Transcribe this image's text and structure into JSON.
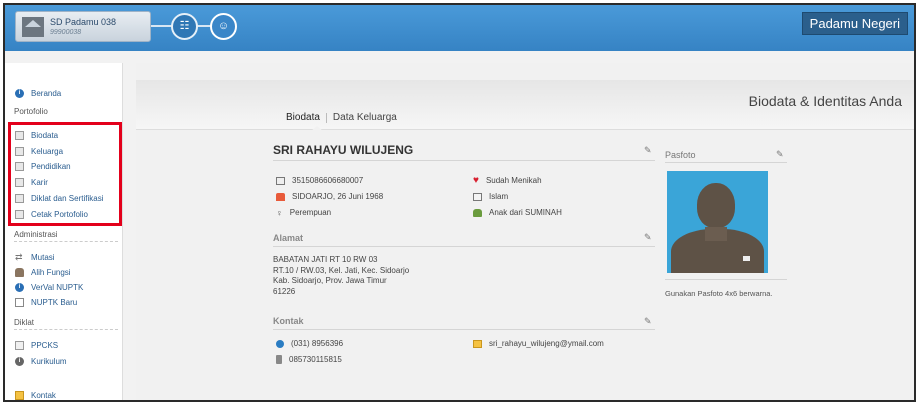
{
  "topbar": {
    "school_name": "SD Padamu 038",
    "school_id": "99900038",
    "brand": "Padamu Negeri"
  },
  "sidebar": {
    "home": "Beranda",
    "portfolio_heading": "Portofolio",
    "portfolio_items": [
      "Biodata",
      "Keluarga",
      "Pendidikan",
      "Karir",
      "Diklat dan Sertifikasi",
      "Cetak Portofolio"
    ],
    "admin_heading": "Administrasi",
    "admin_items": [
      "Mutasi",
      "Alih Fungsi",
      "VerVal NUPTK",
      "NUPTK Baru"
    ],
    "diklat_heading": "Diklat",
    "diklat_items": [
      "PPCKS",
      "Kurikulum"
    ],
    "contact": "Kontak"
  },
  "main": {
    "title": "Biodata & Identitas Anda",
    "tabs": [
      "Biodata",
      "Data Keluarga"
    ],
    "name": "SRI RAHAYU WILUJENG",
    "identity": {
      "nik": "3515086606680007",
      "birth": "SIDOARJO, 26 Juni 1968",
      "gender": "Perempuan",
      "marital": "Sudah Menikah",
      "religion": "Islam",
      "parent": "Anak dari SUMINAH"
    },
    "address_heading": "Alamat",
    "address_lines": [
      "BABATAN JATI RT 10 RW 03",
      "RT.10 / RW.03, Kel. Jati, Kec. Sidoarjo",
      "Kab. Sidoarjo, Prov. Jawa Timur",
      "61226"
    ],
    "contact_heading": "Kontak",
    "contact": {
      "phone": "(031) 8956396",
      "mobile": "085730115815",
      "email": "sri_rahayu_wilujeng@ymail.com"
    },
    "photo_heading": "Pasfoto",
    "photo_note": "Gunakan Pasfoto 4x6 berwarna."
  },
  "colors": {
    "topbar": "#3f8fd0",
    "link": "#2a5d8f",
    "highlight_box": "#e3001b"
  }
}
